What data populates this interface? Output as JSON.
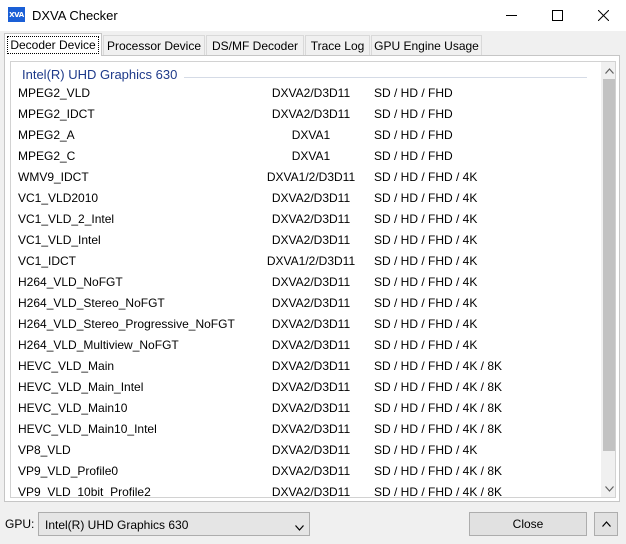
{
  "window": {
    "icon_text": "XVA",
    "title": "DXVA Checker"
  },
  "tabs": [
    {
      "label": "Decoder Device",
      "active": true
    },
    {
      "label": "Processor Device",
      "active": false
    },
    {
      "label": "DS/MF Decoder",
      "active": false
    },
    {
      "label": "Trace Log",
      "active": false
    },
    {
      "label": "GPU Engine Usage",
      "active": false
    }
  ],
  "group": {
    "title": "Intel(R) UHD Graphics 630"
  },
  "rows": [
    {
      "name": "MPEG2_VLD",
      "api": "DXVA2/D3D11",
      "res": "SD / HD / FHD"
    },
    {
      "name": "MPEG2_IDCT",
      "api": "DXVA2/D3D11",
      "res": "SD / HD / FHD"
    },
    {
      "name": "MPEG2_A",
      "api": "DXVA1",
      "res": "SD / HD / FHD"
    },
    {
      "name": "MPEG2_C",
      "api": "DXVA1",
      "res": "SD / HD / FHD"
    },
    {
      "name": "WMV9_IDCT",
      "api": "DXVA1/2/D3D11",
      "res": "SD / HD / FHD / 4K"
    },
    {
      "name": "VC1_VLD2010",
      "api": "DXVA2/D3D11",
      "res": "SD / HD / FHD / 4K"
    },
    {
      "name": "VC1_VLD_2_Intel",
      "api": "DXVA2/D3D11",
      "res": "SD / HD / FHD / 4K"
    },
    {
      "name": "VC1_VLD_Intel",
      "api": "DXVA2/D3D11",
      "res": "SD / HD / FHD / 4K"
    },
    {
      "name": "VC1_IDCT",
      "api": "DXVA1/2/D3D11",
      "res": "SD / HD / FHD / 4K"
    },
    {
      "name": "H264_VLD_NoFGT",
      "api": "DXVA2/D3D11",
      "res": "SD / HD / FHD / 4K"
    },
    {
      "name": "H264_VLD_Stereo_NoFGT",
      "api": "DXVA2/D3D11",
      "res": "SD / HD / FHD / 4K"
    },
    {
      "name": "H264_VLD_Stereo_Progressive_NoFGT",
      "api": "DXVA2/D3D11",
      "res": "SD / HD / FHD / 4K"
    },
    {
      "name": "H264_VLD_Multiview_NoFGT",
      "api": "DXVA2/D3D11",
      "res": "SD / HD / FHD / 4K"
    },
    {
      "name": "HEVC_VLD_Main",
      "api": "DXVA2/D3D11",
      "res": "SD / HD / FHD / 4K / 8K"
    },
    {
      "name": "HEVC_VLD_Main_Intel",
      "api": "DXVA2/D3D11",
      "res": "SD / HD / FHD / 4K / 8K"
    },
    {
      "name": "HEVC_VLD_Main10",
      "api": "DXVA2/D3D11",
      "res": "SD / HD / FHD / 4K / 8K"
    },
    {
      "name": "HEVC_VLD_Main10_Intel",
      "api": "DXVA2/D3D11",
      "res": "SD / HD / FHD / 4K / 8K"
    },
    {
      "name": "VP8_VLD",
      "api": "DXVA2/D3D11",
      "res": "SD / HD / FHD / 4K"
    },
    {
      "name": "VP9_VLD_Profile0",
      "api": "DXVA2/D3D11",
      "res": "SD / HD / FHD / 4K / 8K"
    },
    {
      "name": "VP9_VLD_10bit_Profile2",
      "api": "DXVA2/D3D11",
      "res": "SD / HD / FHD / 4K / 8K"
    }
  ],
  "footer": {
    "gpu_label": "GPU:",
    "gpu_value": "Intel(R) UHD Graphics 630",
    "close_label": "Close"
  },
  "colors": {
    "group_title": "#1e3a8a",
    "app_icon": "#1a5fd6"
  }
}
